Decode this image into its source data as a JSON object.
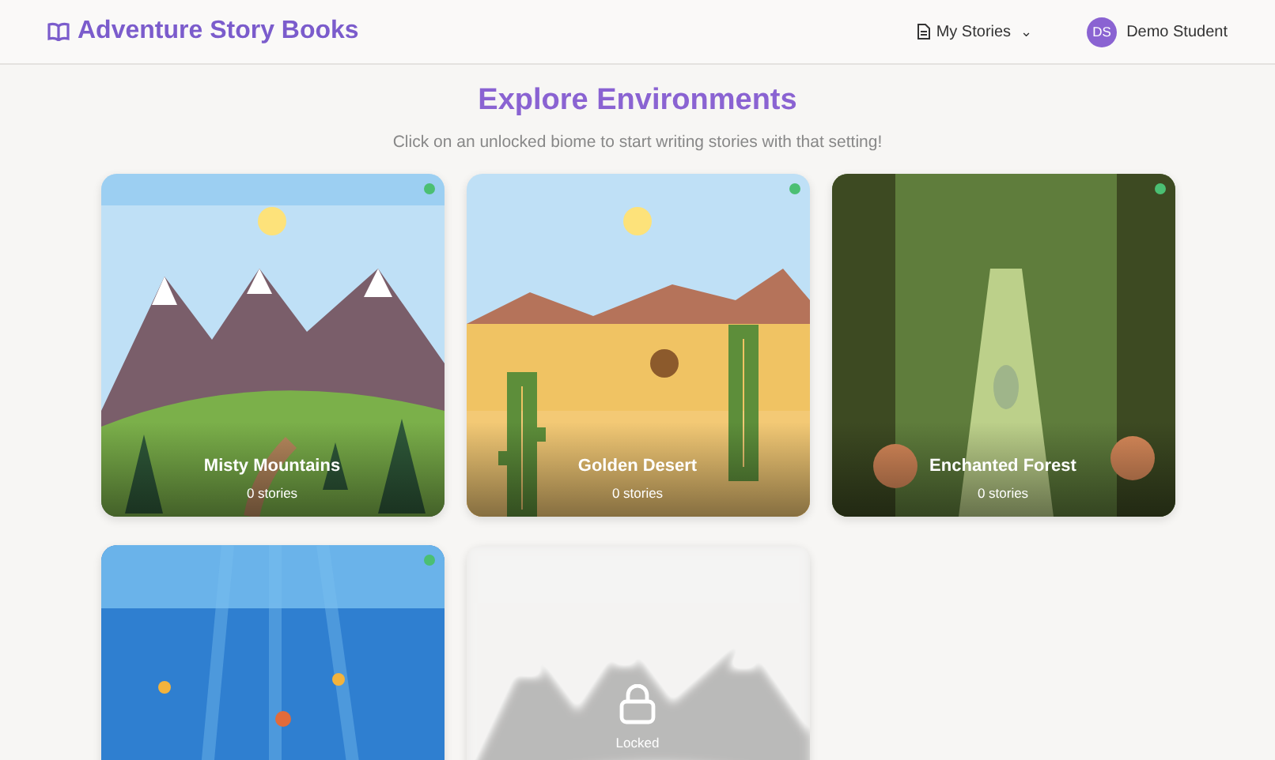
{
  "header": {
    "brand": "Adventure Story Books",
    "menu": {
      "label": "My Stories",
      "caret": "⌄"
    },
    "user": {
      "initials": "DS",
      "name": "Demo Student"
    }
  },
  "heading": "Explore Environments",
  "subtitle": "Click on an unlocked biome to start writing stories with that setting!",
  "biomes": [
    {
      "kind": "mountains",
      "unlocked": true,
      "title": "Misty Mountains",
      "count": "0 stories"
    },
    {
      "kind": "desert",
      "unlocked": true,
      "title": "Golden Desert",
      "count": "0 stories"
    },
    {
      "kind": "forest",
      "unlocked": true,
      "title": "Enchanted Forest",
      "count": "0 stories"
    },
    {
      "kind": "ocean",
      "unlocked": true
    },
    {
      "kind": "mountains",
      "unlocked": false,
      "lock_label": "Locked"
    }
  ]
}
